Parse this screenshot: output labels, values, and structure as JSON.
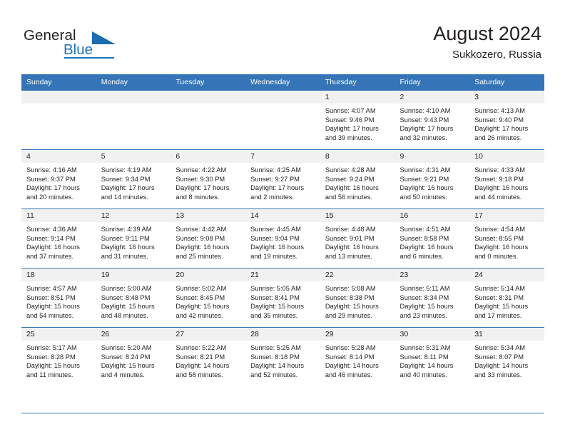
{
  "brand": {
    "word_one": "General",
    "word_two": "Blue",
    "flag_icon": "blue-triangle-flag-icon"
  },
  "header": {
    "title": "August 2024",
    "subtitle": "Sukkozero, Russia"
  },
  "theme": {
    "header_blue": "#3575b7",
    "brand_blue": "#1c75bc",
    "daynum_bg": "#f1f1f1",
    "text": "#231f20"
  },
  "calendar": {
    "weekday_headers": [
      "Sunday",
      "Monday",
      "Tuesday",
      "Wednesday",
      "Thursday",
      "Friday",
      "Saturday"
    ],
    "weeks": [
      [
        {
          "day": "",
          "info": ""
        },
        {
          "day": "",
          "info": ""
        },
        {
          "day": "",
          "info": ""
        },
        {
          "day": "",
          "info": ""
        },
        {
          "day": "1",
          "info": "Sunrise: 4:07 AM\nSunset: 9:46 PM\nDaylight: 17 hours\nand 39 minutes."
        },
        {
          "day": "2",
          "info": "Sunrise: 4:10 AM\nSunset: 9:43 PM\nDaylight: 17 hours\nand 32 minutes."
        },
        {
          "day": "3",
          "info": "Sunrise: 4:13 AM\nSunset: 9:40 PM\nDaylight: 17 hours\nand 26 minutes."
        }
      ],
      [
        {
          "day": "4",
          "info": "Sunrise: 4:16 AM\nSunset: 9:37 PM\nDaylight: 17 hours\nand 20 minutes."
        },
        {
          "day": "5",
          "info": "Sunrise: 4:19 AM\nSunset: 9:34 PM\nDaylight: 17 hours\nand 14 minutes."
        },
        {
          "day": "6",
          "info": "Sunrise: 4:22 AM\nSunset: 9:30 PM\nDaylight: 17 hours\nand 8 minutes."
        },
        {
          "day": "7",
          "info": "Sunrise: 4:25 AM\nSunset: 9:27 PM\nDaylight: 17 hours\nand 2 minutes."
        },
        {
          "day": "8",
          "info": "Sunrise: 4:28 AM\nSunset: 9:24 PM\nDaylight: 16 hours\nand 56 minutes."
        },
        {
          "day": "9",
          "info": "Sunrise: 4:31 AM\nSunset: 9:21 PM\nDaylight: 16 hours\nand 50 minutes."
        },
        {
          "day": "10",
          "info": "Sunrise: 4:33 AM\nSunset: 9:18 PM\nDaylight: 16 hours\nand 44 minutes."
        }
      ],
      [
        {
          "day": "11",
          "info": "Sunrise: 4:36 AM\nSunset: 9:14 PM\nDaylight: 16 hours\nand 37 minutes."
        },
        {
          "day": "12",
          "info": "Sunrise: 4:39 AM\nSunset: 9:11 PM\nDaylight: 16 hours\nand 31 minutes."
        },
        {
          "day": "13",
          "info": "Sunrise: 4:42 AM\nSunset: 9:08 PM\nDaylight: 16 hours\nand 25 minutes."
        },
        {
          "day": "14",
          "info": "Sunrise: 4:45 AM\nSunset: 9:04 PM\nDaylight: 16 hours\nand 19 minutes."
        },
        {
          "day": "15",
          "info": "Sunrise: 4:48 AM\nSunset: 9:01 PM\nDaylight: 16 hours\nand 13 minutes."
        },
        {
          "day": "16",
          "info": "Sunrise: 4:51 AM\nSunset: 8:58 PM\nDaylight: 16 hours\nand 6 minutes."
        },
        {
          "day": "17",
          "info": "Sunrise: 4:54 AM\nSunset: 8:55 PM\nDaylight: 16 hours\nand 0 minutes."
        }
      ],
      [
        {
          "day": "18",
          "info": "Sunrise: 4:57 AM\nSunset: 8:51 PM\nDaylight: 15 hours\nand 54 minutes."
        },
        {
          "day": "19",
          "info": "Sunrise: 5:00 AM\nSunset: 8:48 PM\nDaylight: 15 hours\nand 48 minutes."
        },
        {
          "day": "20",
          "info": "Sunrise: 5:02 AM\nSunset: 8:45 PM\nDaylight: 15 hours\nand 42 minutes."
        },
        {
          "day": "21",
          "info": "Sunrise: 5:05 AM\nSunset: 8:41 PM\nDaylight: 15 hours\nand 35 minutes."
        },
        {
          "day": "22",
          "info": "Sunrise: 5:08 AM\nSunset: 8:38 PM\nDaylight: 15 hours\nand 29 minutes."
        },
        {
          "day": "23",
          "info": "Sunrise: 5:11 AM\nSunset: 8:34 PM\nDaylight: 15 hours\nand 23 minutes."
        },
        {
          "day": "24",
          "info": "Sunrise: 5:14 AM\nSunset: 8:31 PM\nDaylight: 15 hours\nand 17 minutes."
        }
      ],
      [
        {
          "day": "25",
          "info": "Sunrise: 5:17 AM\nSunset: 8:28 PM\nDaylight: 15 hours\nand 11 minutes."
        },
        {
          "day": "26",
          "info": "Sunrise: 5:20 AM\nSunset: 8:24 PM\nDaylight: 15 hours\nand 4 minutes."
        },
        {
          "day": "27",
          "info": "Sunrise: 5:22 AM\nSunset: 8:21 PM\nDaylight: 14 hours\nand 58 minutes."
        },
        {
          "day": "28",
          "info": "Sunrise: 5:25 AM\nSunset: 8:18 PM\nDaylight: 14 hours\nand 52 minutes."
        },
        {
          "day": "29",
          "info": "Sunrise: 5:28 AM\nSunset: 8:14 PM\nDaylight: 14 hours\nand 46 minutes."
        },
        {
          "day": "30",
          "info": "Sunrise: 5:31 AM\nSunset: 8:11 PM\nDaylight: 14 hours\nand 40 minutes."
        },
        {
          "day": "31",
          "info": "Sunrise: 5:34 AM\nSunset: 8:07 PM\nDaylight: 14 hours\nand 33 minutes."
        }
      ]
    ]
  }
}
